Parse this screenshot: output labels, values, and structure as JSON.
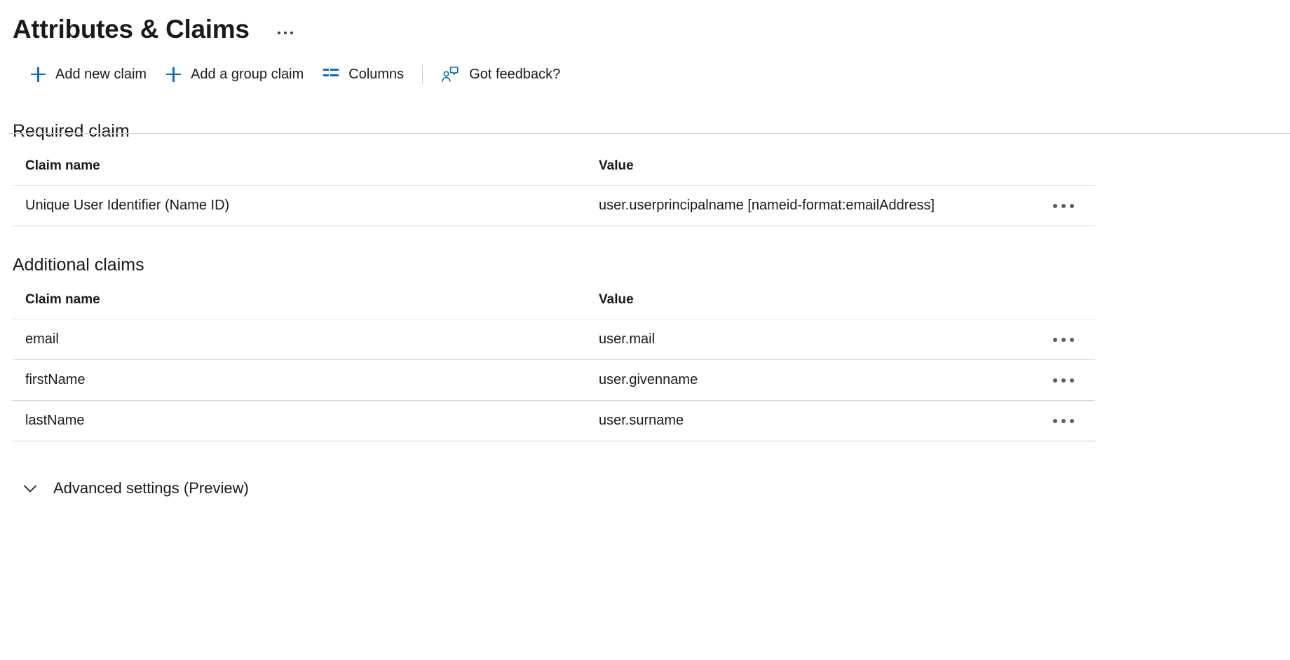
{
  "header": {
    "title": "Attributes & Claims",
    "more_menu_icon": "ellipsis-icon"
  },
  "toolbar": {
    "add_new_claim": "Add new claim",
    "add_group_claim": "Add a group claim",
    "columns": "Columns",
    "got_feedback": "Got feedback?"
  },
  "colors": {
    "accent_blue": "#0f6cbd",
    "text_primary": "#1b1a19",
    "divider": "#d2d0ce"
  },
  "required_section": {
    "title": "Required claim",
    "columns": {
      "name": "Claim name",
      "value": "Value"
    },
    "rows": [
      {
        "name": "Unique User Identifier (Name ID)",
        "value": "user.userprincipalname [nameid-format:emailAddress]"
      }
    ]
  },
  "additional_section": {
    "title": "Additional claims",
    "columns": {
      "name": "Claim name",
      "value": "Value"
    },
    "rows": [
      {
        "name": "email",
        "value": "user.mail"
      },
      {
        "name": "firstName",
        "value": "user.givenname"
      },
      {
        "name": "lastName",
        "value": "user.surname"
      }
    ]
  },
  "advanced": {
    "label": "Advanced settings (Preview)",
    "chevron": "chevron-down-icon"
  }
}
